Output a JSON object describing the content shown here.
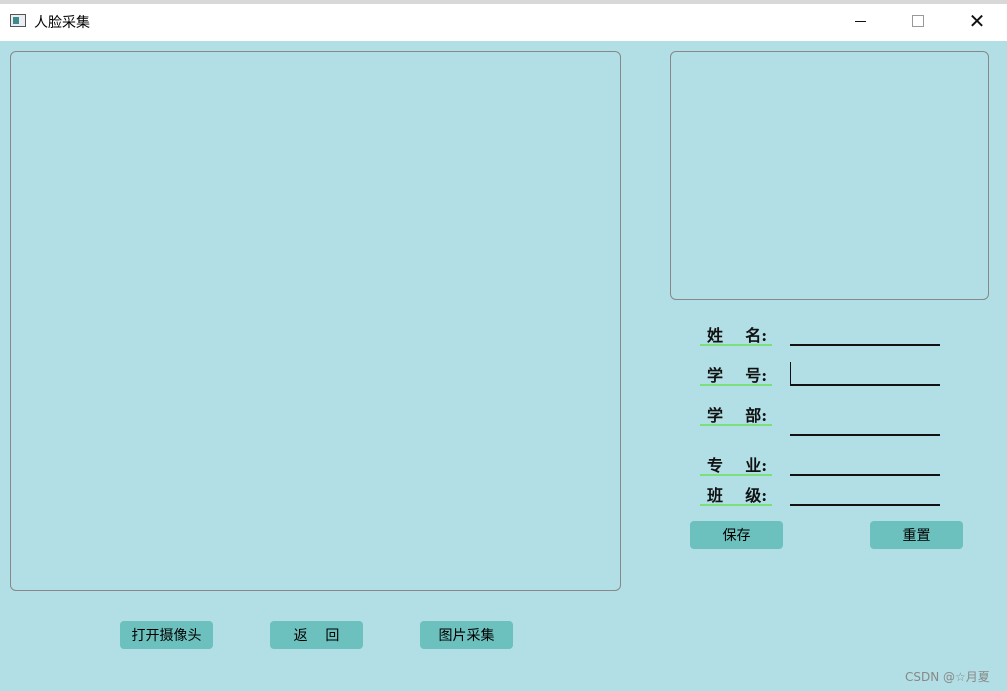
{
  "window": {
    "title": "人脸采集",
    "icon": "app-window-icon",
    "controls": {
      "minimize": "minimize-icon",
      "maximize": "maximize-icon",
      "close": "close-icon",
      "close_glyph": "✕"
    }
  },
  "form": {
    "fields": [
      {
        "label": "姓    名:",
        "value": ""
      },
      {
        "label": "学    号:",
        "value": ""
      },
      {
        "label": "学    部:",
        "value": ""
      },
      {
        "label": "专    业:",
        "value": ""
      },
      {
        "label": "班    级:",
        "value": ""
      }
    ],
    "save_label": "保存",
    "reset_label": "重置"
  },
  "actions": {
    "open_camera": "打开摄像头",
    "back": "返    回",
    "capture": "图片采集"
  },
  "watermark": "CSDN @☆月夏",
  "colors": {
    "background": "#b1dfe5",
    "button": "#6cc0bd",
    "label_underline": "#7be07b"
  }
}
